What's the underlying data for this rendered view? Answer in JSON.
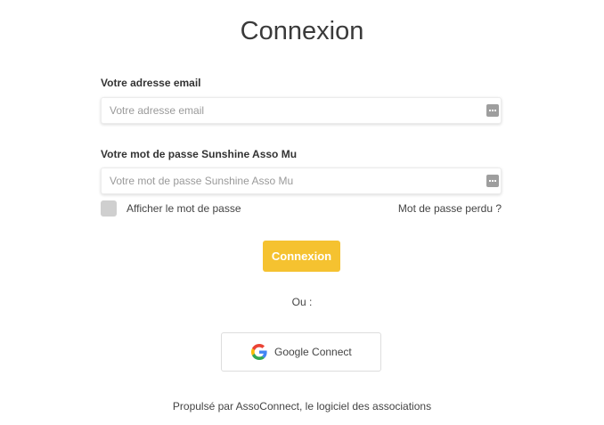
{
  "page": {
    "title": "Connexion"
  },
  "form": {
    "email": {
      "label": "Votre adresse email",
      "placeholder": "Votre adresse email",
      "value": ""
    },
    "password": {
      "label": "Votre mot de passe Sunshine Asso Mu",
      "placeholder": "Votre mot de passe Sunshine Asso Mu",
      "value": ""
    },
    "show_password_label": "Afficher le mot de passe",
    "show_password_checked": false,
    "forgot_password_link": "Mot de passe perdu ?",
    "submit_label": "Connexion"
  },
  "alt_login": {
    "separator": "Ou :",
    "google_label": "Google Connect",
    "google_icon": "google-g-icon"
  },
  "footer": {
    "text": "Propulsé par AssoConnect, le logiciel des associations"
  },
  "colors": {
    "accent": "#f5c230",
    "field_icon": "#9e9e9e",
    "checkbox": "#cfcfcf"
  }
}
